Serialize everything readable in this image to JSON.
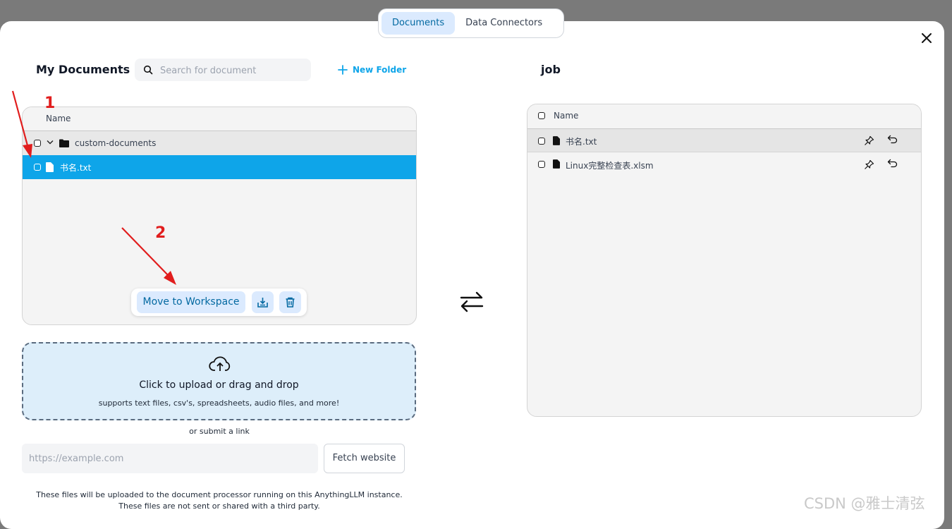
{
  "tabs": [
    {
      "label": "Documents",
      "active": true
    },
    {
      "label": "Data Connectors",
      "active": false
    }
  ],
  "left": {
    "title": "My Documents",
    "search_placeholder": "Search for document",
    "new_folder_label": "New Folder",
    "column_header": "Name",
    "items": [
      {
        "type": "folder",
        "name": "custom-documents"
      },
      {
        "type": "file",
        "name": "书名.txt",
        "selected": true
      }
    ],
    "actions": {
      "move_label": "Move to Workspace",
      "download_icon": "save-to-workspace-icon",
      "delete_icon": "trash-icon"
    }
  },
  "upload": {
    "title": "Click to upload or drag and drop",
    "subtitle": "supports text files, csv's, spreadsheets, audio files, and more!",
    "or_link": "or submit a link",
    "url_placeholder": "https://example.com",
    "fetch_label": "Fetch website",
    "notice_line1": "These files will be uploaded to the document processor running on this AnythingLLM instance.",
    "notice_line2": "These files are not sent or shared with a third party."
  },
  "right": {
    "title": "job",
    "column_header": "Name",
    "items": [
      {
        "name": "书名.txt"
      },
      {
        "name": "Linux完整检查表.xlsm"
      }
    ]
  },
  "annotations": {
    "step1": "1",
    "step2": "2"
  },
  "watermark": "CSDN @雅士清弦",
  "colors": {
    "accent": "#0ea5e9",
    "selected_row": "#0ea5e9",
    "button_bg": "#dbeafe",
    "annotation_red": "#e11d1d",
    "overlay": "#7a7a7a"
  }
}
